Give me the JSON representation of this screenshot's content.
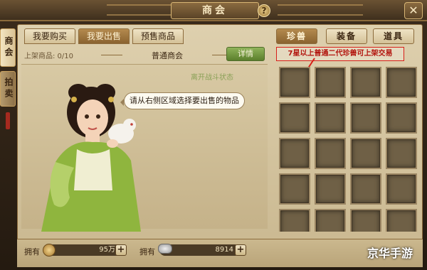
{
  "header": {
    "title": "商会",
    "help_label": "?",
    "close_label": "✕"
  },
  "left_tabs": [
    {
      "label": "商会",
      "active": true
    },
    {
      "label": "拍卖",
      "active": false
    }
  ],
  "sub_tabs": [
    {
      "label": "我要购买",
      "active": false
    },
    {
      "label": "我要出售",
      "active": true
    },
    {
      "label": "预售商品",
      "active": false
    }
  ],
  "category_tabs": [
    {
      "label": "珍兽",
      "active": true
    },
    {
      "label": "装备",
      "active": false
    },
    {
      "label": "道具",
      "active": false
    }
  ],
  "listing": {
    "listed_label": "上架商品: 0/10",
    "shop_name": "普通商会",
    "detail_button": "详情",
    "stage_status": "离开战斗状态",
    "speech_bubble": "请从右侧区域选择要出售的物品"
  },
  "annotation": {
    "warning_text": "7星以上普通二代珍兽可上架交易",
    "color": "#d81f18"
  },
  "grid": {
    "columns": 4,
    "visible_rows": 5,
    "slot_count": 20
  },
  "currency": {
    "own_label_1": "拥有",
    "gold_value": "95万",
    "own_label_2": "拥有",
    "silver_value": "8914",
    "plus_label": "+"
  },
  "watermark": {
    "text": "京华手游"
  }
}
